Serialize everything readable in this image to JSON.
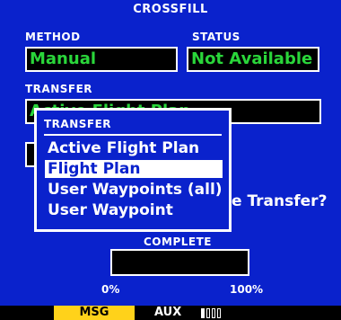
{
  "page": {
    "title": "CROSSFILL",
    "method_label": "METHOD",
    "method_value": "Manual",
    "status_label": "STATUS",
    "status_value": "Not Available",
    "transfer_label": "TRANSFER",
    "transfer_value": "Active Flight Plan",
    "partial_prompt": "e Transfer?"
  },
  "popup": {
    "title": "TRANSFER",
    "items": [
      {
        "label": "Active Flight Plan",
        "selected": false
      },
      {
        "label": "Flight Plan",
        "selected": true
      },
      {
        "label": "User Waypoints (all)",
        "selected": false
      },
      {
        "label": "User Waypoint",
        "selected": false
      }
    ]
  },
  "progress": {
    "label": "COMPLETE",
    "min_label": "0%",
    "max_label": "100%",
    "fraction": 0
  },
  "statusbar": {
    "msg": "MSG",
    "aux": "AUX",
    "page_count": 4,
    "active_page": 1
  },
  "colors": {
    "background": "#0a22cc",
    "field_text": "#2ad63a",
    "msg_highlight": "#ffd21a",
    "text": "#ffffff"
  }
}
